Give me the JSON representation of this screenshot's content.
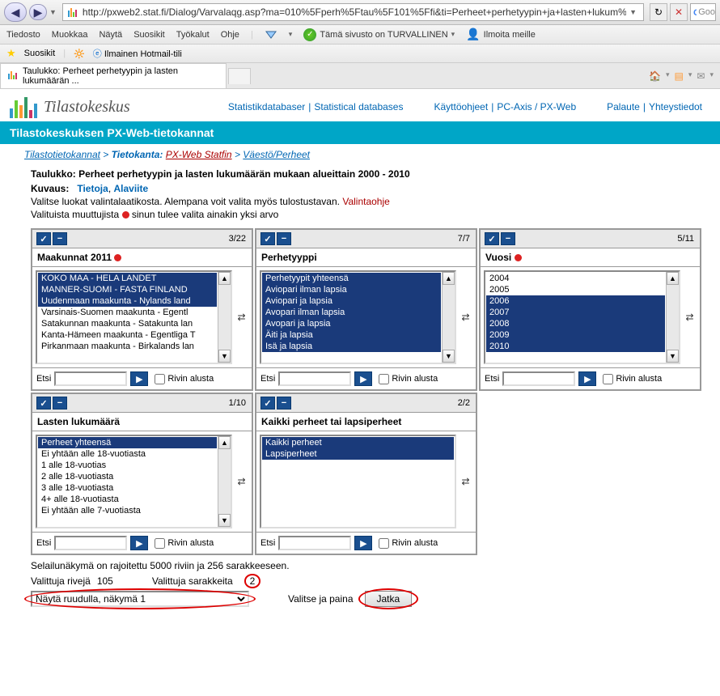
{
  "browser": {
    "url": "http://pxweb2.stat.fi/Dialog/Varvalaqg.asp?ma=010%5Fperh%5Ftau%5F101%5Ffi&ti=Perheet+perhetyypin+ja+lasten+lukum%E",
    "google_placeholder": "Goo"
  },
  "menu": {
    "items": [
      "Tiedosto",
      "Muokkaa",
      "Näytä",
      "Suosikit",
      "Työkalut",
      "Ohje"
    ],
    "safe_text": "Tämä sivusto on TURVALLINEN",
    "report": "Ilmoita meille"
  },
  "favbar": {
    "fav": "Suosikit",
    "hotmail": "Ilmainen Hotmail-tili"
  },
  "tab": {
    "title": "Taulukko: Perheet perhetyypin ja lasten lukumäärän ..."
  },
  "header": {
    "logo": "Tilastokeskus",
    "links": {
      "l1": "Statistikdatabaser",
      "l2": "Statistical databases",
      "l3": "Käyttöohjeet",
      "l4": "PC-Axis / PX-Web",
      "l5": "Palaute",
      "l6": "Yhteystiedot"
    },
    "tealbar": "Tilastokeskuksen PX-Web-tietokannat"
  },
  "breadcrumb": {
    "b1": "Tilastotietokannat",
    "b2label": "Tietokanta:",
    "b2": "PX-Web Statfin",
    "b3": "Väestö/Perheet"
  },
  "meta": {
    "title_label": "Taulukko:",
    "title_text": "Perheet perhetyypin ja lasten lukumäärän mukaan alueittain 2000 - 2010",
    "desc_label": "Kuvaus:",
    "desc_link1": "Tietoja",
    "desc_link2": "Alaviite",
    "instr1_a": "Valitse luokat valintalaatikosta. Alempana voit valita myös tulostustavan.",
    "instr1_link": "Valintaohje",
    "instr2_a": "Valituista muuttujista",
    "instr2_b": "sinun tulee valita ainakin yksi arvo"
  },
  "panels": {
    "p1": {
      "count": "3/22",
      "label": "Maakunnat 2011",
      "mandatory": true,
      "items": [
        {
          "t": "KOKO MAA - HELA LANDET",
          "sel": true
        },
        {
          "t": "MANNER-SUOMI - FASTA FINLAND",
          "sel": true
        },
        {
          "t": "Uudenmaan maakunta - Nylands land",
          "sel": true
        },
        {
          "t": "Varsinais-Suomen maakunta - Egentl",
          "sel": false
        },
        {
          "t": "Satakunnan maakunta - Satakunta lan",
          "sel": false
        },
        {
          "t": "Kanta-Hämeen maakunta - Egentliga T",
          "sel": false
        },
        {
          "t": "Pirkanmaan maakunta - Birkalands lan",
          "sel": false
        }
      ]
    },
    "p2": {
      "count": "7/7",
      "label": "Perhetyyppi",
      "mandatory": false,
      "items": [
        {
          "t": "Perhetyypit yhteensä",
          "sel": true
        },
        {
          "t": "Aviopari ilman lapsia",
          "sel": true
        },
        {
          "t": "Aviopari ja lapsia",
          "sel": true
        },
        {
          "t": "Avopari ilman lapsia",
          "sel": true
        },
        {
          "t": "Avopari ja lapsia",
          "sel": true
        },
        {
          "t": "Äiti ja lapsia",
          "sel": true
        },
        {
          "t": "Isä ja lapsia",
          "sel": true
        }
      ]
    },
    "p3": {
      "count": "5/11",
      "label": "Vuosi",
      "mandatory": true,
      "items": [
        {
          "t": "2004",
          "sel": false
        },
        {
          "t": "2005",
          "sel": false
        },
        {
          "t": "2006",
          "sel": true
        },
        {
          "t": "2007",
          "sel": true
        },
        {
          "t": "2008",
          "sel": true
        },
        {
          "t": "2009",
          "sel": true
        },
        {
          "t": "2010",
          "sel": true
        }
      ]
    },
    "p4": {
      "count": "1/10",
      "label": "Lasten lukumäärä",
      "mandatory": false,
      "items": [
        {
          "t": "Perheet yhteensä",
          "sel": true
        },
        {
          "t": "Ei yhtään alle 18-vuotiasta",
          "sel": false
        },
        {
          "t": "1 alle 18-vuotias",
          "sel": false
        },
        {
          "t": "2 alle 18-vuotiasta",
          "sel": false
        },
        {
          "t": "3 alle 18-vuotiasta",
          "sel": false
        },
        {
          "t": "4+ alle 18-vuotiasta",
          "sel": false
        },
        {
          "t": "Ei yhtään alle 7-vuotiasta",
          "sel": false
        }
      ]
    },
    "p5": {
      "count": "2/2",
      "label": "Kaikki perheet tai lapsiperheet",
      "mandatory": false,
      "items": [
        {
          "t": "Kaikki perheet",
          "sel": true
        },
        {
          "t": "Lapsiperheet",
          "sel": true
        }
      ]
    },
    "search_label": "Etsi",
    "row_start": "Rivin alusta"
  },
  "bottom": {
    "limit": "Selailunäkymä on rajoitettu 5000 riviin ja 256 sarakkeeseen.",
    "rows_label": "Valittuja rivejä",
    "rows_val": "105",
    "cols_label": "Valittuja sarakkeita",
    "cols_val": "2",
    "view_option": "Näytä ruudulla, näkymä 1",
    "choose_label": "Valitse ja paina",
    "continue": "Jatka"
  }
}
